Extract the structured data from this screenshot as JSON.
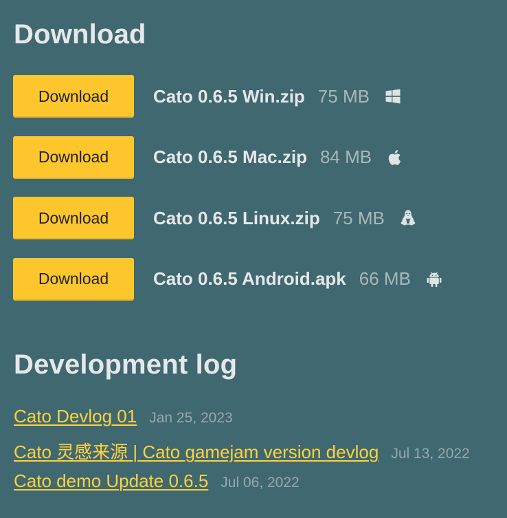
{
  "sections": {
    "download_heading": "Download",
    "devlog_heading": "Development log"
  },
  "downloads": [
    {
      "button_label": "Download",
      "file_name": "Cato 0.6.5 Win.zip",
      "size": "75 MB",
      "platform_icon": "windows-icon"
    },
    {
      "button_label": "Download",
      "file_name": "Cato 0.6.5 Mac.zip",
      "size": "84 MB",
      "platform_icon": "apple-icon"
    },
    {
      "button_label": "Download",
      "file_name": "Cato 0.6.5 Linux.zip",
      "size": "75 MB",
      "platform_icon": "linux-icon"
    },
    {
      "button_label": "Download",
      "file_name": "Cato 0.6.5 Android.apk",
      "size": "66 MB",
      "platform_icon": "android-icon"
    }
  ],
  "devlog": [
    {
      "title": "Cato Devlog 01",
      "date": "Jan 25, 2023"
    },
    {
      "title": "Cato 灵感来源 | Cato gamejam version devlog",
      "date": "Jul 13, 2022"
    },
    {
      "title": "Cato demo Update 0.6.5",
      "date": "Jul 06, 2022"
    }
  ],
  "colors": {
    "background": "#3f6870",
    "button": "#fcc62c",
    "link": "#ffd23f",
    "muted_text": "#a9b7bb"
  }
}
